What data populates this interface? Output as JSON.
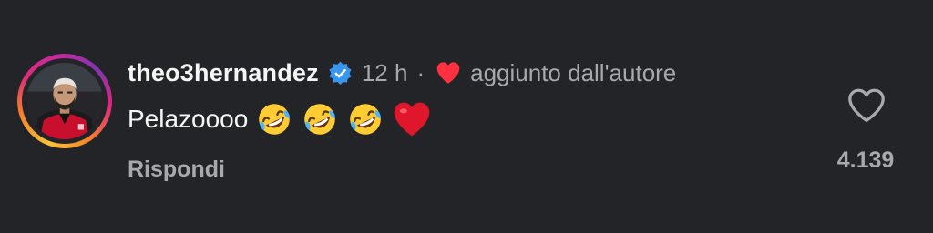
{
  "comment": {
    "username": "theo3hernandez",
    "verified": true,
    "time": "12 h",
    "separator": "·",
    "author_like_text": "aggiunto dall'autore",
    "text": "Pelazoooo",
    "emojis": [
      "rolling-on-floor-laughing",
      "rolling-on-floor-laughing",
      "rolling-on-floor-laughing",
      "red-heart"
    ],
    "reply_label": "Rispondi",
    "like_count": "4.139"
  },
  "colors": {
    "background": "#232428",
    "primary_text": "#f5f5f5",
    "secondary_text": "#a8a8ad",
    "verified_blue": "#3797f0",
    "heart_red": "#ff3040"
  }
}
